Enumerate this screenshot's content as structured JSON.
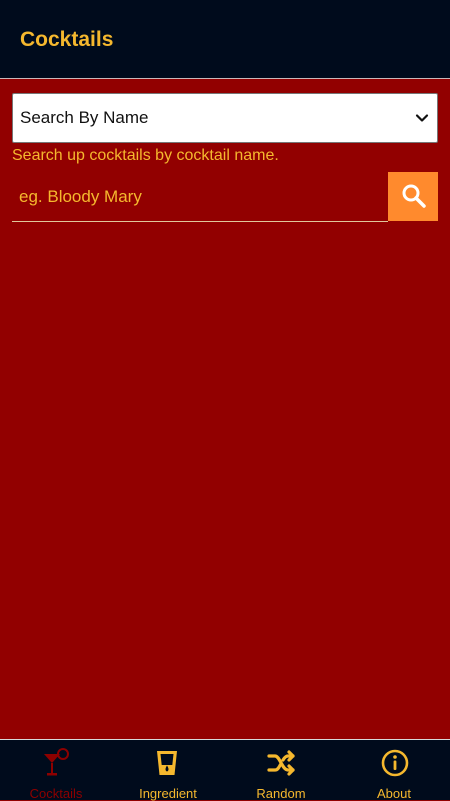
{
  "header": {
    "title": "Cocktails"
  },
  "search_type": {
    "selected": "Search By Name"
  },
  "hint": "Search up cocktails by cocktail name.",
  "search": {
    "placeholder": "eg. Bloody Mary",
    "value": ""
  },
  "bottom_nav": {
    "items": [
      {
        "label": "Cocktails",
        "icon": "cocktail-icon",
        "active": true
      },
      {
        "label": "Ingredient",
        "icon": "glass-icon",
        "active": false
      },
      {
        "label": "Random",
        "icon": "shuffle-icon",
        "active": false
      },
      {
        "label": "About",
        "icon": "info-icon",
        "active": false
      }
    ]
  },
  "colors": {
    "background": "#920000",
    "bar": "#000b1c",
    "accent": "#f5b82e",
    "button": "#ff8a2d",
    "active": "#8d0000"
  }
}
